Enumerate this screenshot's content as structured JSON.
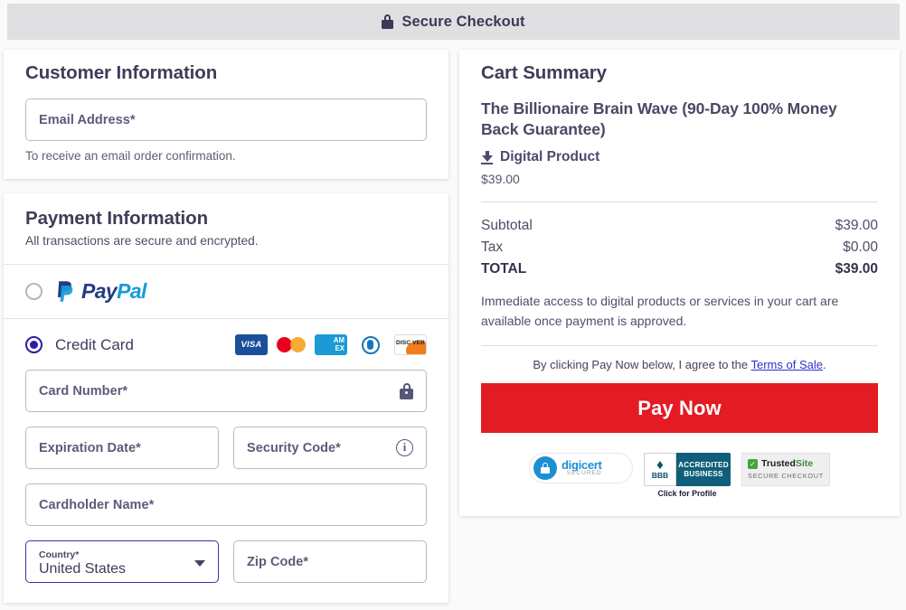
{
  "header": {
    "title": "Secure Checkout",
    "lock_icon": "lock-icon",
    "background": "#e0e0e3"
  },
  "customer": {
    "section_title": "Customer Information",
    "email_placeholder": "Email Address*",
    "email_value": "",
    "helper_text": "To receive an email order confirmation."
  },
  "payment": {
    "section_title": "Payment Information",
    "subtitle": "All transactions are secure and encrypted.",
    "methods": [
      {
        "id": "paypal",
        "label": "PayPal",
        "selected": false
      },
      {
        "id": "credit-card",
        "label": "Credit Card",
        "selected": true
      }
    ],
    "paypal_word_1": "Pay",
    "paypal_word_2": "Pal",
    "card_brands": [
      {
        "id": "visa",
        "label": "VISA"
      },
      {
        "id": "mastercard",
        "label": ""
      },
      {
        "id": "amex",
        "label_top": "AM",
        "label_bottom": "EX"
      },
      {
        "id": "diners",
        "label": ""
      },
      {
        "id": "discover",
        "label": "DISC VER"
      }
    ],
    "fields": {
      "card_number_placeholder": "Card Number*",
      "card_number_value": "",
      "card_number_icon": "lock-icon",
      "expiration_placeholder": "Expiration Date*",
      "expiration_value": "",
      "security_code_placeholder": "Security Code*",
      "security_code_value": "",
      "security_code_icon": "info-icon",
      "cardholder_placeholder": "Cardholder Name*",
      "cardholder_value": "",
      "country_label": "Country*",
      "country_value": "United States",
      "zip_placeholder": "Zip Code*",
      "zip_value": ""
    }
  },
  "cart": {
    "section_title": "Cart Summary",
    "product_name": "The Billionaire Brain Wave (90-Day 100% Money Back Guarantee)",
    "product_type": "Digital Product",
    "product_type_icon": "download-icon",
    "item_price": "$39.00",
    "totals": [
      {
        "label": "Subtotal",
        "value": "$39.00",
        "emphasis": false
      },
      {
        "label": "Tax",
        "value": "$0.00",
        "emphasis": false
      },
      {
        "label": "TOTAL",
        "value": "$39.00",
        "emphasis": true
      }
    ],
    "note": "Immediate access to digital products or services in your cart are available once payment is approved.",
    "terms_prefix": "By clicking Pay Now below, I agree to the ",
    "terms_link": "Terms of Sale",
    "terms_suffix": ".",
    "pay_button_label": "Pay Now",
    "pay_button_color": "#e31b23"
  },
  "badges": {
    "digicert": {
      "name": "digicert",
      "sub": "SECURED"
    },
    "bbb": {
      "torch": "BBB",
      "line1": "ACCREDITED",
      "line2": "BUSINESS",
      "caption": "Click for Profile"
    },
    "trustedsite": {
      "name_dark": "Trusted",
      "name_light": "Site",
      "sub": "SECURE CHECKOUT",
      "check": "✓"
    }
  }
}
